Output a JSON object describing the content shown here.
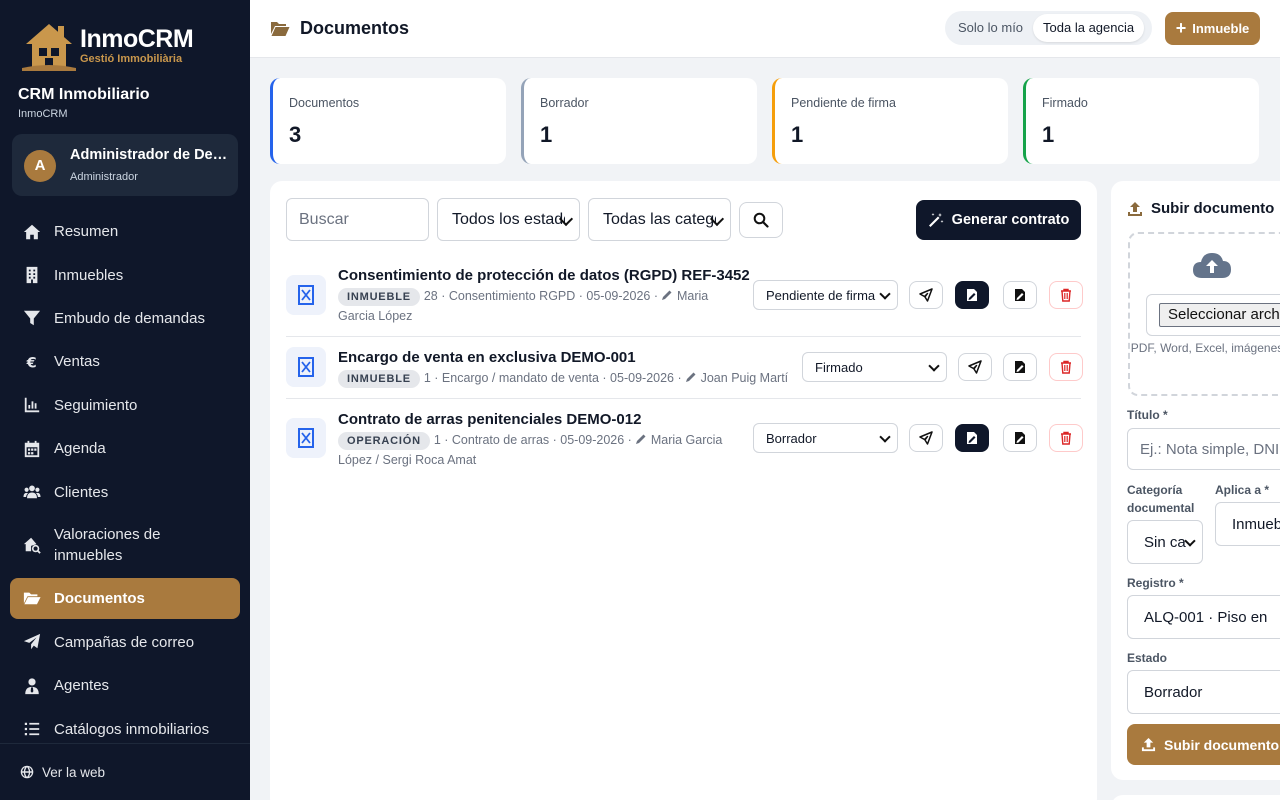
{
  "brand": {
    "name": "InmoCRM",
    "tagline": "Gestió Immobiliària"
  },
  "crm": {
    "title": "CRM Inmobiliario",
    "subtitle": "InmoCRM"
  },
  "user": {
    "initial": "A",
    "name": "Administrador de Demo",
    "role": "Administrador"
  },
  "nav": [
    {
      "label": "Resumen",
      "icon": "home-icon"
    },
    {
      "label": "Inmuebles",
      "icon": "building-icon"
    },
    {
      "label": "Embudo de demandas",
      "icon": "funnel-icon"
    },
    {
      "label": "Ventas",
      "icon": "euro-icon"
    },
    {
      "label": "Seguimiento",
      "icon": "chart-icon"
    },
    {
      "label": "Agenda",
      "icon": "calendar-icon"
    },
    {
      "label": "Clientes",
      "icon": "users-icon"
    },
    {
      "label": "Valoraciones de inmuebles",
      "icon": "house-search-icon"
    },
    {
      "label": "Documentos",
      "icon": "folder-open-icon",
      "active": true
    },
    {
      "label": "Campañas de correo",
      "icon": "paper-plane-icon"
    },
    {
      "label": "Agentes",
      "icon": "user-tie-icon"
    },
    {
      "label": "Catálogos inmobiliarios",
      "icon": "list-icon"
    }
  ],
  "footer": {
    "label": "Ver la web"
  },
  "header": {
    "title": "Documentos",
    "scope_mine": "Solo lo mío",
    "scope_all": "Toda la agencia",
    "add_button": "Inmueble"
  },
  "stats": [
    {
      "label": "Documentos",
      "value": "3",
      "color": "#2563eb"
    },
    {
      "label": "Borrador",
      "value": "1",
      "color": "#94a3b8"
    },
    {
      "label": "Pendiente de firma",
      "value": "1",
      "color": "#f59e0b"
    },
    {
      "label": "Firmado",
      "value": "1",
      "color": "#16a34a"
    }
  ],
  "filters": {
    "search_placeholder": "Buscar",
    "status": "Todos los estados",
    "category": "Todas las categorías",
    "generate_button": "Generar contrato"
  },
  "documents": [
    {
      "title": "Consentimiento de protección de datos (RGPD) REF-3452",
      "badge": "INMUEBLE",
      "meta": "28 · Consentimiento RGPD · 05-09-2026 ·",
      "people": "Maria Garcia López",
      "status": "Pendiente de firma"
    },
    {
      "title": "Encargo de venta en exclusiva DEMO-001",
      "badge": "INMUEBLE",
      "meta": "1 · Encargo / mandato de venta · 05-09-2026 ·",
      "people": "Joan Puig Martí",
      "status": "Firmado"
    },
    {
      "title": "Contrato de arras penitenciales DEMO-012",
      "badge": "OPERACIÓN",
      "meta": "1 · Contrato de arras · 05-09-2026 ·",
      "people": "Maria Garcia López / Sergi Roca Amat",
      "status": "Borrador"
    }
  ],
  "upload": {
    "title": "Subir documento",
    "file_button": "Seleccionar archivo",
    "hint": "PDF, Word, Excel, imágenes...",
    "title_label": "Título *",
    "title_placeholder": "Ej.: Nota simple, DNI",
    "category_label": "Categoría documental",
    "category_value": "Sin categoría",
    "applies_label": "Aplica a *",
    "applies_value": "Inmueble",
    "record_label": "Registro *",
    "record_value": "ALQ-001 · Piso en",
    "status_label": "Estado",
    "status_value": "Borrador",
    "submit_button": "Subir documento"
  }
}
